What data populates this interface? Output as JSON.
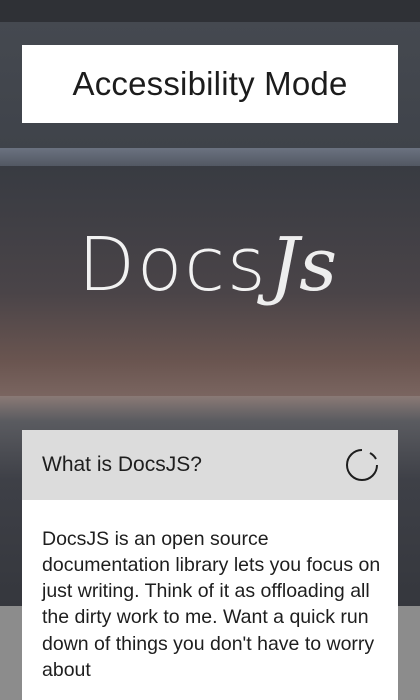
{
  "accessibility": {
    "button_label": "Accessibility Mode"
  },
  "logo": {
    "main_text": "Docs",
    "script_text": "Js"
  },
  "card": {
    "title": "What is DocsJS?",
    "icon": "loading-spinner-icon",
    "body": "DocsJS is an open source documentation library lets you focus on just writing. Think of it as offloading all the dirty work to me. Want a quick run down of things you don't have to worry about"
  },
  "colors": {
    "card_header_bg": "#dcdcdc",
    "card_bg": "#ffffff",
    "logo_text": "#f2f2f2"
  }
}
